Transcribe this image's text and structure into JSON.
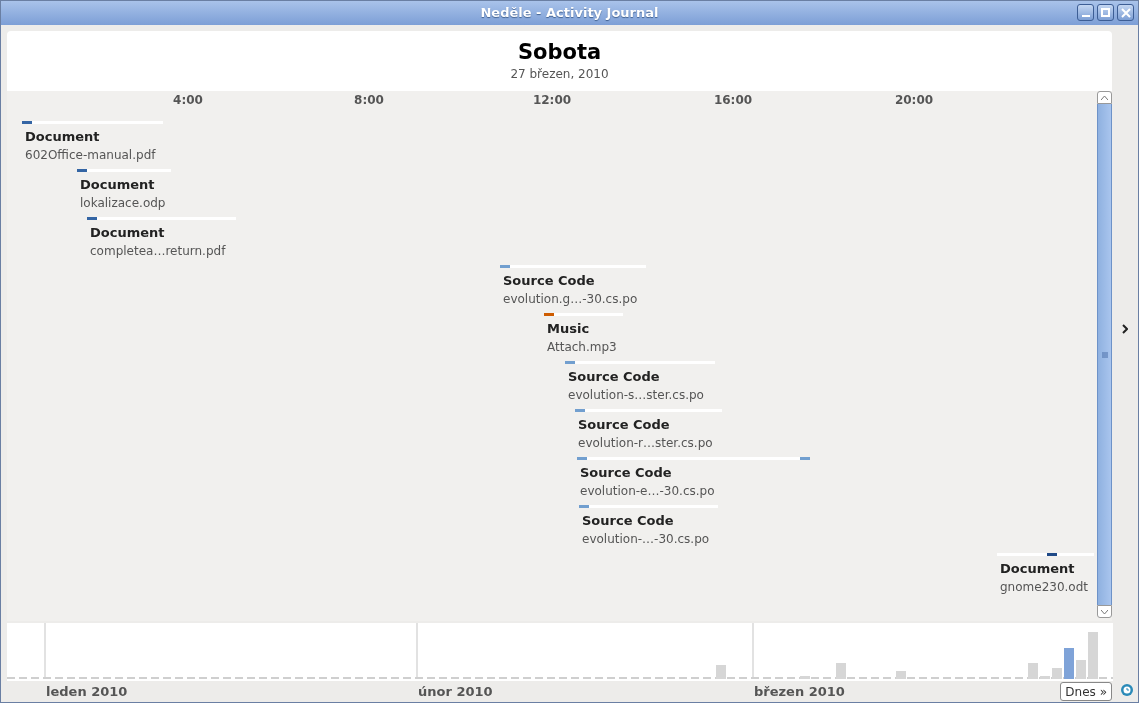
{
  "window": {
    "title": "Neděle - Activity Journal"
  },
  "day": {
    "name": "Sobota",
    "date": "27 březen, 2010"
  },
  "hours": [
    "4:00",
    "8:00",
    "12:00",
    "16:00",
    "20:00"
  ],
  "events": [
    {
      "category": "Document",
      "file": "602Office-manual.pdf",
      "color": "#3465a4"
    },
    {
      "category": "Document",
      "file": "lokalizace.odp",
      "color": "#3465a4"
    },
    {
      "category": "Document",
      "file": "completea…return.pdf",
      "color": "#3465a4"
    },
    {
      "category": "Source Code",
      "file": "evolution.g…-30.cs.po",
      "color": "#729fcf"
    },
    {
      "category": "Music",
      "file": "Attach.mp3",
      "color": "#ce5c00"
    },
    {
      "category": "Source Code",
      "file": "evolution-s…ster.cs.po",
      "color": "#729fcf"
    },
    {
      "category": "Source Code",
      "file": "evolution-r…ster.cs.po",
      "color": "#729fcf"
    },
    {
      "category": "Source Code",
      "file": "evolution-e…-30.cs.po",
      "color": "#729fcf"
    },
    {
      "category": "Source Code",
      "file": "evolution-…-30.cs.po",
      "color": "#729fcf"
    },
    {
      "category": "Document",
      "file": "gnome230.odt",
      "color": "#204a87"
    }
  ],
  "months": [
    "leden 2010",
    "únor 2010",
    "březen 2010"
  ],
  "today_button": "Dnes »"
}
